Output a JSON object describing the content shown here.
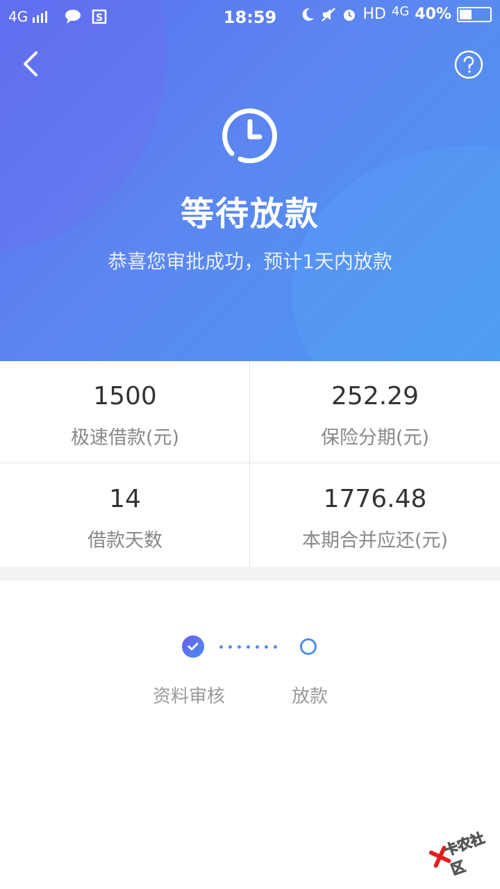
{
  "status_bar": {
    "network": "4G",
    "time": "18:59",
    "hd": "HD",
    "net_right": "4G",
    "battery": "40%",
    "battery_level": 0.4
  },
  "header": {
    "title": "等待放款",
    "subtitle": "恭喜您审批成功，预计1天内放款"
  },
  "summary": [
    {
      "value": "1500",
      "label": "极速借款(元)"
    },
    {
      "value": "252.29",
      "label": "保险分期(元)"
    },
    {
      "value": "14",
      "label": "借款天数"
    },
    {
      "value": "1776.48",
      "label": "本期合并应还(元)"
    }
  ],
  "progress": {
    "steps": [
      {
        "label": "资料审核",
        "state": "done"
      },
      {
        "label": "放款",
        "state": "pending"
      }
    ]
  },
  "watermark": {
    "text": "卡农社区"
  },
  "colors": {
    "accent": "#4c8ef0",
    "header_start": "#5a6ff0",
    "header_end": "#4a9af0"
  }
}
